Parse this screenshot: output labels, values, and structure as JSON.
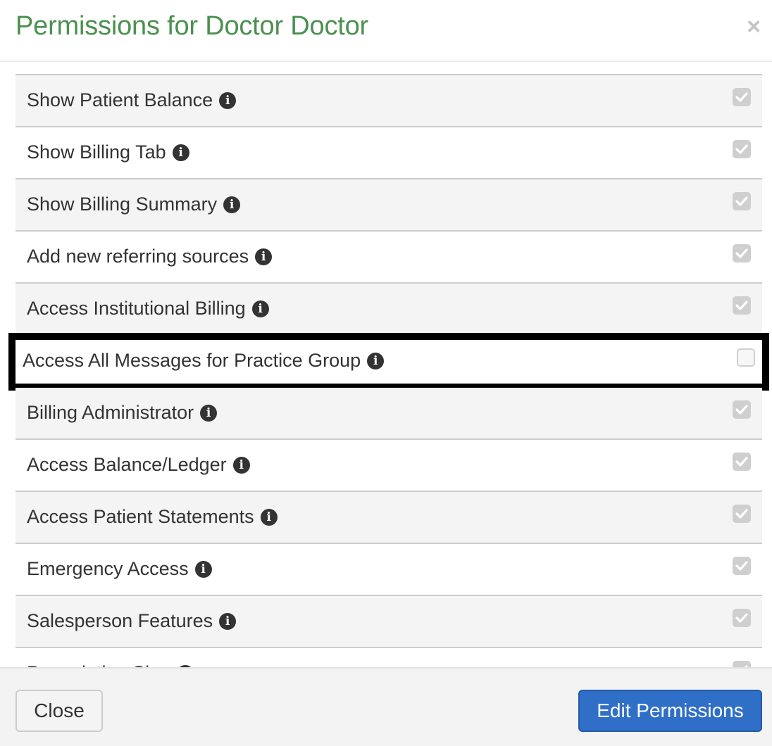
{
  "header": {
    "title": "Permissions for Doctor Doctor",
    "close_glyph": "×"
  },
  "permissions": [
    {
      "label": "Show Patient Balance",
      "checked": true,
      "disabled": true
    },
    {
      "label": "Show Billing Tab",
      "checked": true,
      "disabled": true
    },
    {
      "label": "Show Billing Summary",
      "checked": true,
      "disabled": true
    },
    {
      "label": "Add new referring sources",
      "checked": true,
      "disabled": true
    },
    {
      "label": "Access Institutional Billing",
      "checked": true,
      "disabled": true
    },
    {
      "label": "Access All Messages for Practice Group",
      "checked": false,
      "disabled": true,
      "highlighted": true
    },
    {
      "label": "Billing Administrator",
      "checked": true,
      "disabled": true
    },
    {
      "label": "Access Balance/Ledger",
      "checked": true,
      "disabled": true
    },
    {
      "label": "Access Patient Statements",
      "checked": true,
      "disabled": true
    },
    {
      "label": "Emergency Access",
      "checked": true,
      "disabled": true
    },
    {
      "label": "Salesperson Features",
      "checked": true,
      "disabled": true
    },
    {
      "label": "Prescription Sign",
      "checked": true,
      "disabled": true
    }
  ],
  "info_icon_glyph": "i",
  "footer": {
    "close_label": "Close",
    "edit_label": "Edit Permissions"
  },
  "colors": {
    "title": "#4a9150",
    "primary_button": "#2f6fc8",
    "highlight_border": "#000000"
  }
}
